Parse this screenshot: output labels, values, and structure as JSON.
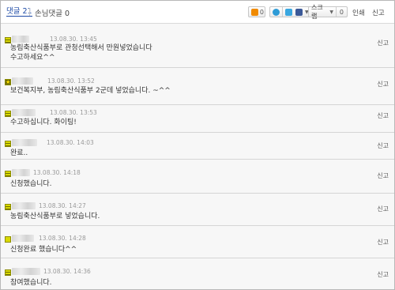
{
  "header": {
    "tab_comments": "댓글 21",
    "tab_guest": "손님댓글 0",
    "like_count": "0",
    "share_count": "0",
    "scrap_label": "스크랩",
    "scrap_count": "0",
    "print_label": "인쇄",
    "report_label": "신고"
  },
  "comments": [
    {
      "date": "13.08.30. 13:45",
      "lines": [
        "농림축산식품부로 관청선택해서 만원넣었습니다",
        "수고하세요^^"
      ],
      "report": "신고"
    },
    {
      "date": "13.08.30. 13:52",
      "lines": [
        "보건복지부, 농림축산식품부 2군데 넣었습니다. ~^^"
      ],
      "report": "신고"
    },
    {
      "date": "13.08.30. 13:53",
      "lines": [
        "수고하십니다. 화이팅!"
      ],
      "report": "신고"
    },
    {
      "date": "13.08.30. 14:03",
      "lines": [
        "완료.."
      ],
      "report": "신고"
    },
    {
      "date": "13.08.30. 14:18",
      "lines": [
        "신청했습니다."
      ],
      "report": "신고"
    },
    {
      "date": "13.08.30. 14:27",
      "lines": [
        "농림축산식품부로 넣었습니다."
      ],
      "report": "신고"
    },
    {
      "date": "13.08.30. 14:28",
      "lines": [
        "신청완료 했습니다^^"
      ],
      "report": "신고"
    },
    {
      "date": "13.08.30. 14:36",
      "lines": [
        "참여했습니다."
      ],
      "report": "신고"
    }
  ],
  "colors": {
    "link_blue": "#1d4aa6",
    "row_bg": "#f7f7f7",
    "icon_yellow": "#d9d900"
  },
  "icons": [
    "like-icon",
    "me2day-icon",
    "twitter-icon",
    "facebook-icon",
    "comment-badge-icon"
  ]
}
